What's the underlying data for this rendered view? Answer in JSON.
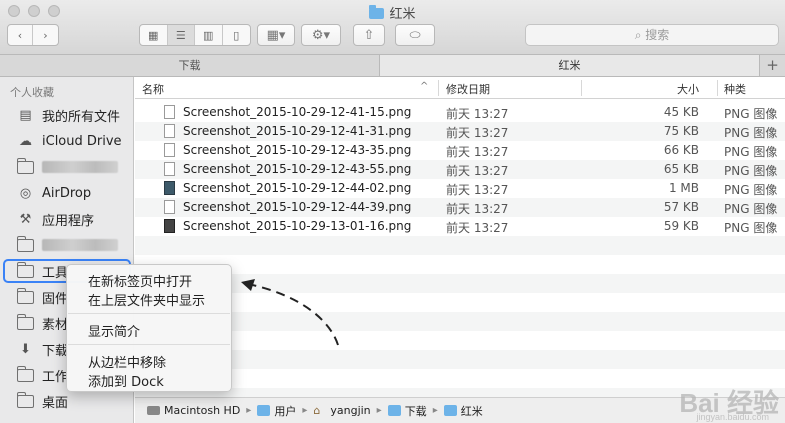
{
  "window": {
    "title": "红米"
  },
  "toolbar": {
    "search_placeholder": "搜索"
  },
  "tabs": [
    {
      "label": "下载"
    },
    {
      "label": "红米"
    }
  ],
  "sidebar": {
    "header": "个人收藏",
    "items": [
      {
        "label": "我的所有文件",
        "icon": "all-files-icon"
      },
      {
        "label": "iCloud Drive",
        "icon": "cloud-icon"
      },
      {
        "label": "",
        "icon": "folder-icon"
      },
      {
        "label": "AirDrop",
        "icon": "airdrop-icon"
      },
      {
        "label": "应用程序",
        "icon": "applications-icon"
      },
      {
        "label": "",
        "icon": "folder-icon"
      },
      {
        "label": "工具",
        "icon": "folder-icon"
      },
      {
        "label": "固件",
        "icon": "folder-icon"
      },
      {
        "label": "素材",
        "icon": "folder-icon"
      },
      {
        "label": "下载",
        "icon": "download-icon"
      },
      {
        "label": "工作",
        "icon": "folder-icon"
      },
      {
        "label": "桌面",
        "icon": "folder-icon"
      }
    ]
  },
  "list": {
    "columns": {
      "name": "名称",
      "date": "修改日期",
      "size": "大小",
      "kind": "种类"
    },
    "files": [
      {
        "name": "Screenshot_2015-10-29-12-41-15.png",
        "date": "前天 13:27",
        "size": "45 KB",
        "kind": "PNG 图像"
      },
      {
        "name": "Screenshot_2015-10-29-12-41-31.png",
        "date": "前天 13:27",
        "size": "75 KB",
        "kind": "PNG 图像"
      },
      {
        "name": "Screenshot_2015-10-29-12-43-35.png",
        "date": "前天 13:27",
        "size": "66 KB",
        "kind": "PNG 图像"
      },
      {
        "name": "Screenshot_2015-10-29-12-43-55.png",
        "date": "前天 13:27",
        "size": "65 KB",
        "kind": "PNG 图像"
      },
      {
        "name": "Screenshot_2015-10-29-12-44-02.png",
        "date": "前天 13:27",
        "size": "1 MB",
        "kind": "PNG 图像"
      },
      {
        "name": "Screenshot_2015-10-29-12-44-39.png",
        "date": "前天 13:27",
        "size": "57 KB",
        "kind": "PNG 图像"
      },
      {
        "name": "Screenshot_2015-10-29-13-01-16.png",
        "date": "前天 13:27",
        "size": "59 KB",
        "kind": "PNG 图像"
      }
    ]
  },
  "pathbar": [
    {
      "label": "Macintosh HD",
      "icon": "hard-disk-icon"
    },
    {
      "label": "用户",
      "icon": "folder-icon"
    },
    {
      "label": "yangjin",
      "icon": "home-icon"
    },
    {
      "label": "下载",
      "icon": "download-folder-icon"
    },
    {
      "label": "红米",
      "icon": "folder-icon"
    }
  ],
  "context_menu": {
    "items": [
      {
        "label": "在新标签页中打开"
      },
      {
        "label": "在上层文件夹中显示"
      },
      {
        "label": "显示简介"
      },
      {
        "label": "从边栏中移除"
      },
      {
        "label": "添加到 Dock"
      }
    ]
  },
  "watermark": {
    "text": "Bai 经验",
    "sub": "jingyan.baidu.com"
  }
}
